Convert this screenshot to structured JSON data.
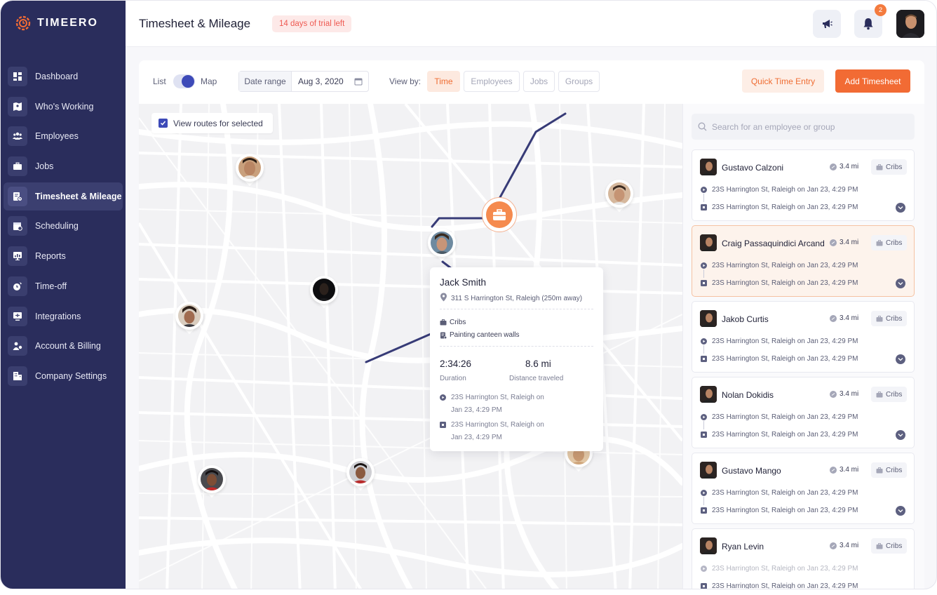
{
  "brand": {
    "name": "TIMEERO"
  },
  "colors": {
    "sidebar": "#2a2d5c",
    "accent": "#f26b34",
    "primary": "#3d4ab8",
    "route": "#373b77"
  },
  "sidebar": {
    "items": [
      {
        "label": "Dashboard",
        "icon": "dashboard-icon"
      },
      {
        "label": "Who's Working",
        "icon": "map-icon"
      },
      {
        "label": "Employees",
        "icon": "employees-icon"
      },
      {
        "label": "Jobs",
        "icon": "briefcase-icon"
      },
      {
        "label": "Timesheet & Mileage",
        "icon": "timesheet-icon",
        "active": true
      },
      {
        "label": "Scheduling",
        "icon": "calendar-icon"
      },
      {
        "label": "Reports",
        "icon": "reports-icon"
      },
      {
        "label": "Time-off",
        "icon": "time-off-icon"
      },
      {
        "label": "Integrations",
        "icon": "integrations-icon"
      },
      {
        "label": "Account & Billing",
        "icon": "billing-icon"
      },
      {
        "label": "Company Settings",
        "icon": "building-icon"
      }
    ]
  },
  "header": {
    "title": "Timesheet & Mileage",
    "trial": "14 days of trial left",
    "notifications": "2"
  },
  "toolbar": {
    "list_label": "List",
    "map_label": "Map",
    "date_range_label": "Date range",
    "date_value": "Aug 3, 2020",
    "view_by_label": "View by:",
    "views": [
      "Time",
      "Employees",
      "Jobs",
      "Groups"
    ],
    "quick_entry": "Quick Time Entry",
    "add_timesheet": "Add Timesheet"
  },
  "map": {
    "view_routes_label": "View routes for selected",
    "popup": {
      "name": "Jack Smith",
      "address": "311 S Harrington St, Raleigh (250m away)",
      "job": "Cribs",
      "task": "Painting canteen walls",
      "duration": "2:34:26",
      "duration_label": "Duration",
      "distance": "8.6 mi",
      "distance_label": "Distance traveled",
      "start_line1": "23S Harrington St, Raleigh on",
      "start_line2": "Jan 23, 4:29 PM",
      "end_line1": "23S Harrington St, Raleigh on",
      "end_line2": "Jan 23, 4:29 PM"
    }
  },
  "panel": {
    "search_placeholder": "Search for an employee or group",
    "employees": [
      {
        "name": "Gustavo Calzoni",
        "distance": "3.4 mi",
        "job": "Cribs",
        "start": "23S Harrington St, Raleigh on  Jan 23, 4:29 PM",
        "end": "23S Harrington St, Raleigh on  Jan 23, 4:29 PM"
      },
      {
        "name": "Craig Passaquindici Arcand",
        "distance": "3.4 mi",
        "job": "Cribs",
        "start": "23S Harrington St, Raleigh on  Jan 23, 4:29 PM",
        "end": "23S Harrington St, Raleigh on  Jan 23, 4:29 PM",
        "selected": true
      },
      {
        "name": "Jakob Curtis",
        "distance": "3.4 mi",
        "job": "Cribs",
        "start": "23S Harrington St, Raleigh on  Jan 23, 4:29 PM",
        "end": "23S Harrington St, Raleigh on  Jan 23, 4:29 PM"
      },
      {
        "name": "Nolan Dokidis",
        "distance": "3.4 mi",
        "job": "Cribs",
        "start": "23S Harrington St, Raleigh on  Jan 23, 4:29 PM",
        "end": "23S Harrington St, Raleigh on  Jan 23, 4:29 PM"
      },
      {
        "name": "Gustavo Mango",
        "distance": "3.4 mi",
        "job": "Cribs",
        "start": "23S Harrington St, Raleigh on  Jan 23, 4:29 PM",
        "end": "23S Harrington St, Raleigh on  Jan 23, 4:29 PM"
      },
      {
        "name": "Ryan Levin",
        "distance": "3.4 mi",
        "job": "Cribs",
        "start": "23S Harrington St, Raleigh on  Jan 23, 4:29 PM",
        "end": "23S Harrington St, Raleigh on  Jan 23, 4:29 PM"
      }
    ]
  }
}
